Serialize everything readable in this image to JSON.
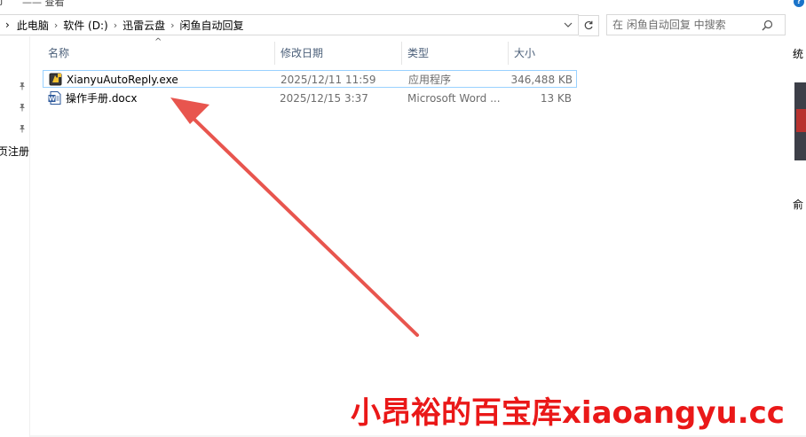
{
  "ribbon": {
    "fragment_left": "ƒ",
    "fragment_mid": "—— 查看",
    "help_label": "?"
  },
  "address": {
    "crumbs": [
      "此电脑",
      "软件 (D:)",
      "迅雷云盘",
      "闲鱼自动回复"
    ]
  },
  "search": {
    "placeholder": "在 闲鱼自动回复 中搜索"
  },
  "nav": {
    "clipped_label": "页注册",
    "pins": [
      "pin-icon",
      "pin-icon",
      "pin-icon"
    ]
  },
  "columns": {
    "name": "名称",
    "modified": "修改日期",
    "type": "类型",
    "size": "大小"
  },
  "files": [
    {
      "name": "XianyuAutoReply.exe",
      "modified": "2025/12/11 11:59",
      "type": "应用程序",
      "size": "346,488 KB",
      "icon": "exe-app-icon",
      "selected": true
    },
    {
      "name": "操作手册.docx",
      "modified": "2025/12/15 3:37",
      "type": "Microsoft Word ...",
      "size": "13 KB",
      "icon": "word-doc-icon",
      "selected": false
    }
  ],
  "right_panel": {
    "text_top": "统",
    "text_bottom": "俞"
  },
  "watermark": "小昂裕的百宝库xiaoangyu.cc",
  "colors": {
    "accent_border": "#99d1ff",
    "header_text": "#4c607a",
    "meta_text": "#6d6d6d",
    "annotation_arrow": "#e8554e",
    "watermark": "#ea1818"
  }
}
